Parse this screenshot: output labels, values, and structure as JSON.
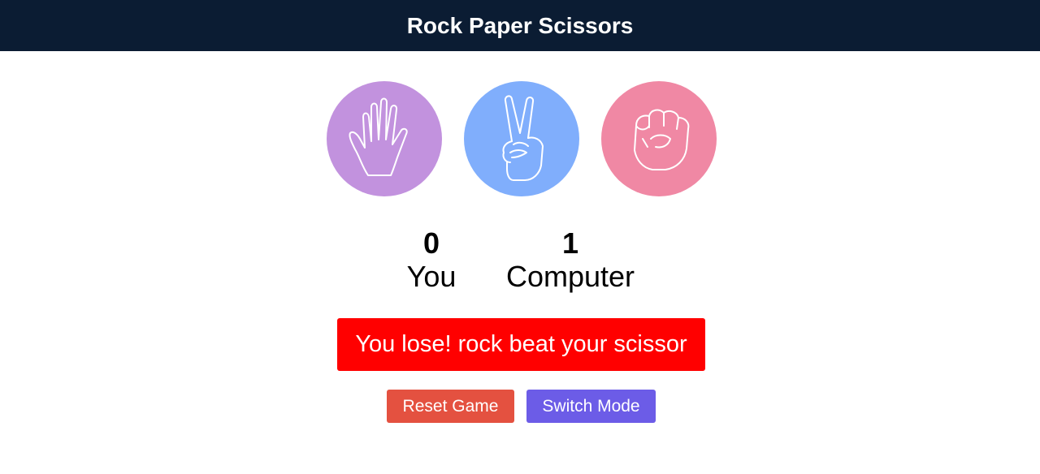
{
  "header": {
    "title": "Rock Paper Scissors"
  },
  "choices": [
    {
      "name": "paper",
      "icon": "open-hand-icon",
      "color": "#c292de"
    },
    {
      "name": "scissors",
      "icon": "peace-hand-icon",
      "color": "#80aefc"
    },
    {
      "name": "rock",
      "icon": "fist-icon",
      "color": "#f088a4"
    }
  ],
  "scores": {
    "user": {
      "value": "0",
      "label": "You"
    },
    "computer": {
      "value": "1",
      "label": "Computer"
    }
  },
  "result": {
    "message": "You lose! rock beat your scissor",
    "color": "#ff0000"
  },
  "controls": {
    "reset_label": "Reset Game",
    "reset_color": "#e45140",
    "switch_label": "Switch Mode",
    "switch_color": "#6c5ce7"
  }
}
